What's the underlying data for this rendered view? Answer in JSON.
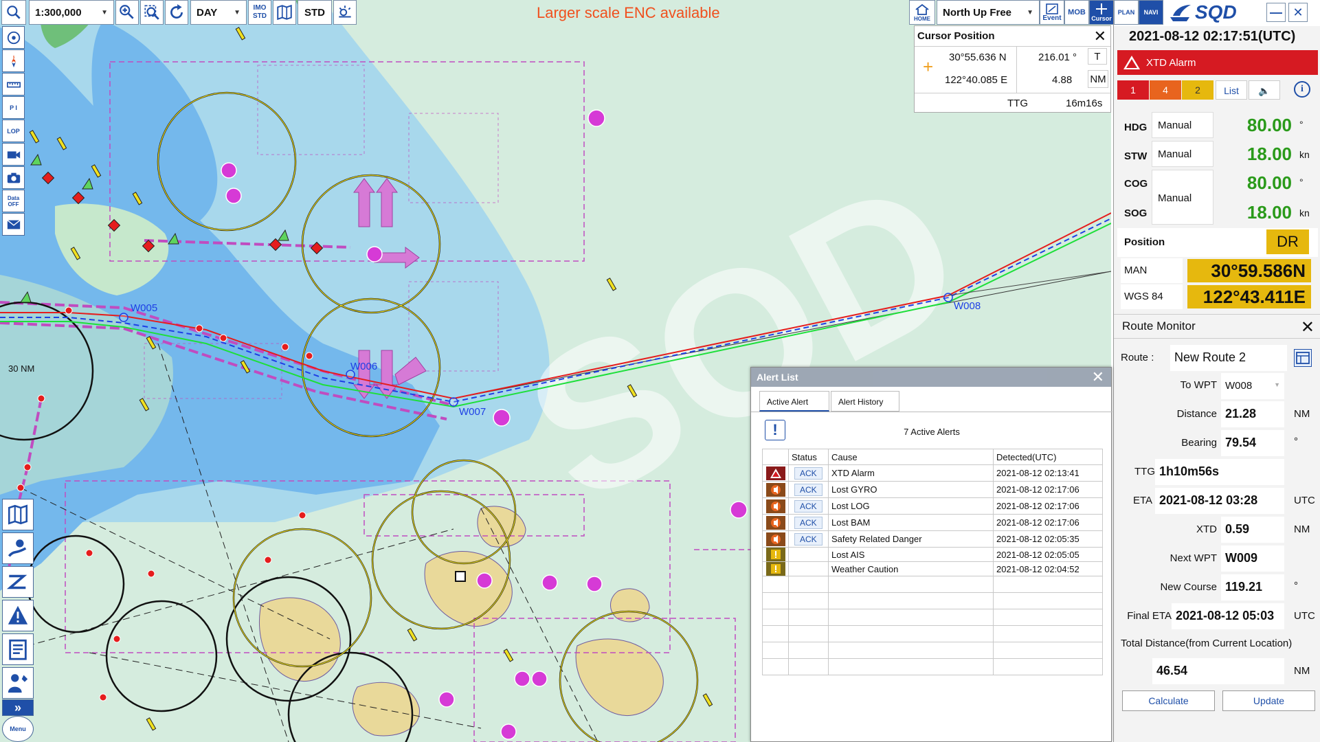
{
  "toolbar": {
    "scale": "1:300,000",
    "display_mode": "DAY",
    "imo_std_top": "IMO",
    "imo_std_bottom": "STD",
    "std_label": "STD",
    "orientation": "North Up Free",
    "home_label": "HOME",
    "event_label": "Event",
    "mob_label": "MOB",
    "cursor_label": "Cursor",
    "plan_label": "PLAN",
    "navi_label": "NAVI",
    "brand": "SQD"
  },
  "banner": "Larger scale ENC available",
  "left_toolbar": {
    "pi": "P I",
    "lop": "LOP",
    "data_off": "Data OFF",
    "menu": "Menu"
  },
  "cursor_position": {
    "title": "Cursor Position",
    "lat": "30°55.636 N",
    "lon": "122°40.085 E",
    "bearing": "216.01 °",
    "bearing_ref": "T",
    "distance": "4.88",
    "distance_unit": "NM",
    "ttg_label": "TTG",
    "ttg": "16m16s"
  },
  "status": {
    "datetime": "2021-08-12 02:17:51(UTC)",
    "alarm": "XTD Alarm",
    "counts": [
      "1",
      "4",
      "2"
    ],
    "list_btn": "List",
    "hdg": {
      "label": "HDG",
      "mode": "Manual",
      "value": "80.00",
      "unit": "°"
    },
    "stw": {
      "label": "STW",
      "mode": "Manual",
      "value": "18.00",
      "unit": "kn"
    },
    "cog": {
      "label": "COG",
      "value": "80.00",
      "unit": "°"
    },
    "sog": {
      "label": "SOG",
      "value": "18.00",
      "unit": "kn"
    },
    "cog_sog_mode": "Manual",
    "position_label": "Position",
    "position_src": "DR",
    "man_label": "MAN",
    "wgs_label": "WGS 84",
    "lat": "30°59.586N",
    "lon": "122°43.411E"
  },
  "route_monitor": {
    "title": "Route Monitor",
    "route_label": "Route :",
    "route": "New Route 2",
    "to_wpt_label": "To WPT",
    "to_wpt": "W008",
    "distance_label": "Distance",
    "distance": "21.28",
    "distance_unit": "NM",
    "bearing_label": "Bearing",
    "bearing": "79.54",
    "bearing_unit": "°",
    "ttg_label": "TTG",
    "ttg": "1h10m56s",
    "eta_label": "ETA",
    "eta": "2021-08-12 03:28",
    "eta_unit": "UTC",
    "xtd_label": "XTD",
    "xtd": "0.59",
    "xtd_unit": "NM",
    "next_wpt_label": "Next WPT",
    "next_wpt": "W009",
    "new_course_label": "New Course",
    "new_course": "119.21",
    "new_course_unit": "°",
    "final_eta_label": "Final ETA",
    "final_eta": "2021-08-12 05:03",
    "final_eta_unit": "UTC",
    "total_label": "Total Distance(from Current Location)",
    "total": "46.54",
    "total_unit": "NM",
    "calculate": "Calculate",
    "update": "Update"
  },
  "alert_list": {
    "title": "Alert List",
    "tab_active": "Active Alert",
    "tab_history": "Alert History",
    "active_count": "7   Active Alerts",
    "headers": [
      "Status",
      "Cause",
      "Detected(UTC)"
    ],
    "rows": [
      {
        "icon": "alarm",
        "ack": "ACK",
        "cause": "XTD Alarm",
        "time": "2021-08-12 02:13:41"
      },
      {
        "icon": "warning",
        "ack": "ACK",
        "cause": "Lost GYRO",
        "time": "2021-08-12 02:17:06"
      },
      {
        "icon": "warning",
        "ack": "ACK",
        "cause": "Lost LOG",
        "time": "2021-08-12 02:17:06"
      },
      {
        "icon": "warning",
        "ack": "ACK",
        "cause": "Lost BAM",
        "time": "2021-08-12 02:17:06"
      },
      {
        "icon": "warning",
        "ack": "ACK",
        "cause": "Safety Related Danger",
        "time": "2021-08-12 02:05:35"
      },
      {
        "icon": "caution",
        "ack": "",
        "cause": "Lost AIS",
        "time": "2021-08-12 02:05:05"
      },
      {
        "icon": "caution",
        "ack": "",
        "cause": "Weather Caution",
        "time": "2021-08-12 02:04:52"
      }
    ]
  },
  "map": {
    "waypoints": [
      "W005",
      "W006",
      "W007",
      "W008"
    ],
    "range_label": "30 NM",
    "watermark": "SQD"
  },
  "colors": {
    "brand_blue": "#1f4fa8",
    "alarm_red": "#d61a22",
    "speed_green": "#2a9a1a",
    "position_yellow": "#e6b80e",
    "sea_deep": "#74b8ec",
    "sea_shallow": "#a8d8ec",
    "land": "#f2e6b4"
  }
}
